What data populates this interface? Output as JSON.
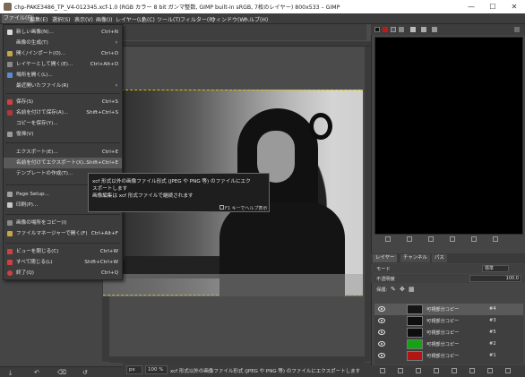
{
  "window": {
    "title": "chp-PAKE3486_TP_V4-012345.xcf-1.0 (RGB カラー 8 bit ガンマ整数, GIMP built-in sRGB, 7枚のレイヤー) 800x533 – GIMP",
    "minimize": "—",
    "maximize": "☐",
    "close": "✕"
  },
  "menubar": [
    "ファイル(F)",
    "編集(E)",
    "選択(S)",
    "表示(V)",
    "画像(I)",
    "レイヤー(L)",
    "色(C)",
    "ツール(T)",
    "フィルター(R)",
    "ウィンドウ(W)",
    "ヘルプ(H)"
  ],
  "file_menu": [
    {
      "label": "新しい画像(N)...",
      "shortcut": "Ctrl+N",
      "icon": "new-image-icon"
    },
    {
      "label": "画像の生成(T)",
      "submenu": true,
      "icon": "create-icon"
    },
    {
      "label": "開く/インポート(O)...",
      "shortcut": "Ctrl+O",
      "icon": "open-icon"
    },
    {
      "label": "レイヤーとして開く(E)...",
      "shortcut": "Ctrl+Alt+O",
      "icon": "open-as-layers-icon"
    },
    {
      "label": "場所を開く(L)...",
      "icon": "open-location-icon"
    },
    {
      "label": "最近開いたファイル(R)",
      "submenu": true,
      "icon": "recent-icon"
    },
    {
      "label": "保存(S)",
      "shortcut": "Ctrl+S",
      "icon": "save-icon"
    },
    {
      "label": "名前を付けて保存(A)...",
      "shortcut": "Shift+Ctrl+S",
      "icon": "save-as-icon"
    },
    {
      "label": "コピーを保存(Y)...",
      "icon": "save-copy-icon"
    },
    {
      "label": "復帰(V)",
      "icon": "revert-icon"
    },
    {
      "label": "エクスポート(E)...",
      "shortcut": "Ctrl+E",
      "icon": "export-icon"
    },
    {
      "label": "名前を付けてエクスポート(X)...",
      "shortcut": "Shift+Ctrl+E",
      "icon": "export-as-icon",
      "highlighted": true
    },
    {
      "label": "テンプレートの作成(T)...",
      "icon": "template-icon"
    },
    {
      "label": "Page Setup...",
      "icon": "page-setup-icon"
    },
    {
      "label": "印刷(P)...",
      "icon": "print-icon"
    },
    {
      "label": "画像の場所をコピー(I)",
      "icon": "copy-location-icon"
    },
    {
      "label": "ファイルマネージャーで開く(F)",
      "shortcut": "Ctrl+Alt+F",
      "icon": "file-manager-icon"
    },
    {
      "label": "ビューを閉じる(C)",
      "shortcut": "Ctrl+W",
      "icon": "close-view-icon"
    },
    {
      "label": "すべて閉じる(L)",
      "shortcut": "Shift+Ctrl+W",
      "icon": "close-all-icon"
    },
    {
      "label": "終了(Q)",
      "shortcut": "Ctrl+Q",
      "icon": "quit-icon"
    }
  ],
  "tooltip": {
    "line1": "xcf 形式以外の画像ファイル形式 (JPEG や PNG 等) のファイルにエク",
    "line2": "スポートします",
    "line3": "画像編集は xcf 形式ファイルで継続されます",
    "help": "F1 キーでヘルプ表示"
  },
  "statusbar": {
    "unit": "px",
    "zoom": "100 %",
    "message": "xcf 形式以外の画像ファイル形式 (JPEG や PNG 等) のファイルにエクスポートします"
  },
  "right_panel": {
    "tabs": [
      "レイヤー",
      "チャンネル",
      "パス"
    ],
    "mode_label": "モード",
    "mode_value": "標準",
    "opacity_label": "不透明度",
    "opacity_value": "100.0",
    "lock_label": "保護:",
    "layers": [
      {
        "name": "可視部分コピー",
        "num": "#4",
        "selected": true,
        "thumb_color": "#151515"
      },
      {
        "name": "可視部分コピー",
        "num": "#3",
        "selected": false,
        "thumb_color": "#0e0e0e"
      },
      {
        "name": "可視部分コピー",
        "num": "#5",
        "selected": false,
        "thumb_color": "#0e0e0e"
      },
      {
        "name": "可視部分コピー",
        "num": "#2",
        "selected": false,
        "thumb_color": "#13a313"
      },
      {
        "name": "可視部分コピー",
        "num": "#1",
        "selected": false,
        "thumb_color": "#b31515"
      }
    ]
  },
  "colors": {
    "accent_highlight": "#595959",
    "selection_border": "#d8c000"
  }
}
